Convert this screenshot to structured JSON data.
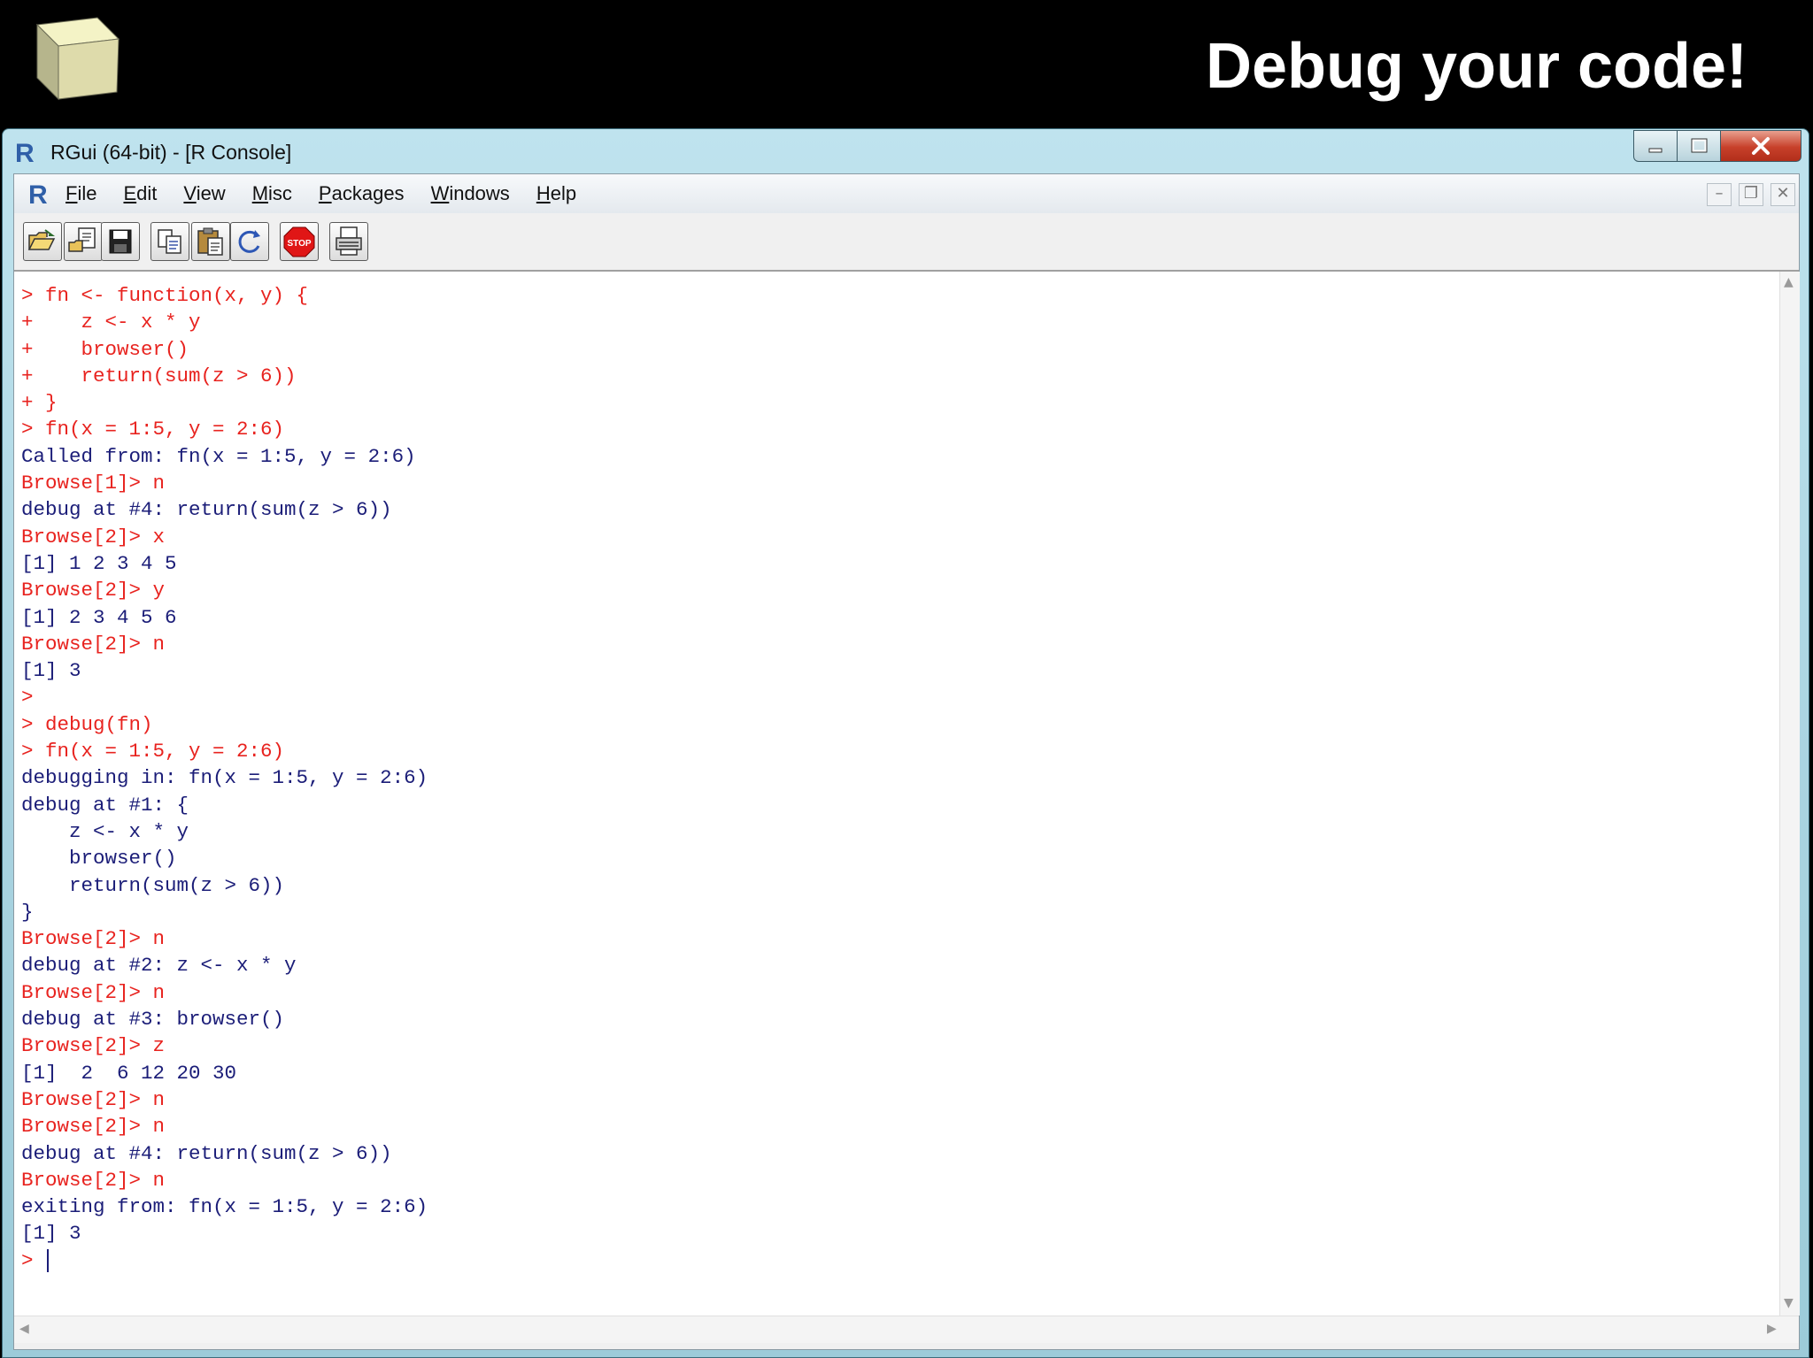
{
  "slide": {
    "title": "Debug your code!"
  },
  "window": {
    "title": "RGui (64-bit) - [R Console]"
  },
  "menu": [
    {
      "key": "F",
      "rest": "ile"
    },
    {
      "key": "E",
      "rest": "dit"
    },
    {
      "key": "V",
      "rest": "iew"
    },
    {
      "key": "M",
      "rest": "isc"
    },
    {
      "key": "P",
      "rest": "ackages"
    },
    {
      "key": "W",
      "rest": "indows"
    },
    {
      "key": "H",
      "rest": "elp"
    }
  ],
  "toolbar": {
    "icons": [
      "open-script-icon",
      "load-workspace-icon",
      "save-workspace-icon",
      "copy-icon",
      "paste-icon",
      "refresh-icon",
      "stop-icon",
      "print-icon"
    ],
    "stop_label": "STOP"
  },
  "colors": {
    "input": "#e8231f",
    "output": "#1b1d78"
  },
  "console": [
    {
      "t": "> fn <- function(x, y) {",
      "type": "in"
    },
    {
      "t": "+    z <- x * y",
      "type": "in"
    },
    {
      "t": "+    browser()",
      "type": "in"
    },
    {
      "t": "+    return(sum(z > 6))",
      "type": "in"
    },
    {
      "t": "+ }",
      "type": "in"
    },
    {
      "t": "> fn(x = 1:5, y = 2:6)",
      "type": "in"
    },
    {
      "t": "Called from: fn(x = 1:5, y = 2:6)",
      "type": "out"
    },
    {
      "t": "Browse[1]> n",
      "type": "in"
    },
    {
      "t": "debug at #4: return(sum(z > 6))",
      "type": "out"
    },
    {
      "t": "Browse[2]> x",
      "type": "in"
    },
    {
      "t": "[1] 1 2 3 4 5",
      "type": "out"
    },
    {
      "t": "Browse[2]> y",
      "type": "in"
    },
    {
      "t": "[1] 2 3 4 5 6",
      "type": "out"
    },
    {
      "t": "Browse[2]> n",
      "type": "in"
    },
    {
      "t": "[1] 3",
      "type": "out"
    },
    {
      "t": ">",
      "type": "in"
    },
    {
      "t": "> debug(fn)",
      "type": "in"
    },
    {
      "t": "> fn(x = 1:5, y = 2:6)",
      "type": "in"
    },
    {
      "t": "debugging in: fn(x = 1:5, y = 2:6)",
      "type": "out"
    },
    {
      "t": "debug at #1: {",
      "type": "out"
    },
    {
      "t": "    z <- x * y",
      "type": "out"
    },
    {
      "t": "    browser()",
      "type": "out"
    },
    {
      "t": "    return(sum(z > 6))",
      "type": "out"
    },
    {
      "t": "}",
      "type": "out"
    },
    {
      "t": "Browse[2]> n",
      "type": "in"
    },
    {
      "t": "debug at #2: z <- x * y",
      "type": "out"
    },
    {
      "t": "Browse[2]> n",
      "type": "in"
    },
    {
      "t": "debug at #3: browser()",
      "type": "out"
    },
    {
      "t": "Browse[2]> z",
      "type": "in"
    },
    {
      "t": "[1]  2  6 12 20 30",
      "type": "out"
    },
    {
      "t": "Browse[2]> n",
      "type": "in"
    },
    {
      "t": "Browse[2]> n",
      "type": "in"
    },
    {
      "t": "debug at #4: return(sum(z > 6))",
      "type": "out"
    },
    {
      "t": "Browse[2]> n",
      "type": "in"
    },
    {
      "t": "exiting from: fn(x = 1:5, y = 2:6)",
      "type": "out"
    },
    {
      "t": "[1] 3",
      "type": "out"
    },
    {
      "t": "> ",
      "type": "in",
      "caret": true
    }
  ]
}
